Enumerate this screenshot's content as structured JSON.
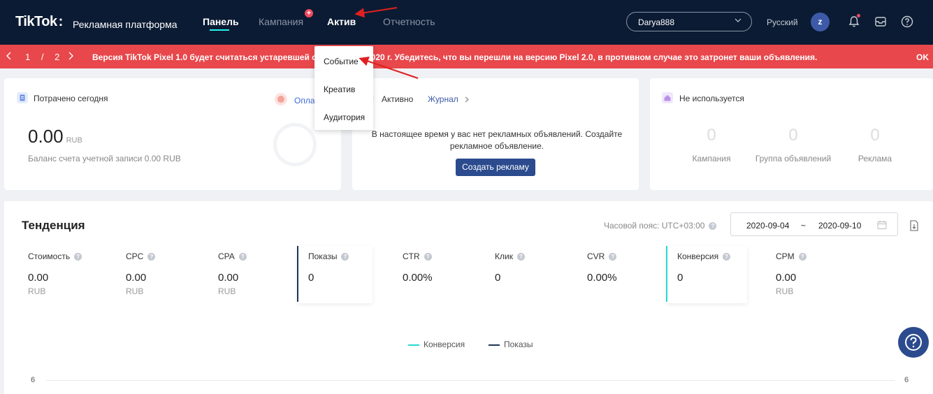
{
  "colors": {
    "nav_bg": "#0b1b33",
    "banner_bg": "#e8474b",
    "accent_cyan": "#25f4ee",
    "button_blue": "#2b4b8e",
    "conversion_line": "#25d9d4",
    "impressions_line": "#1f3556",
    "annotation_arrow": "#e02020"
  },
  "header": {
    "logo": "TikTok",
    "logo_colon": ":",
    "subtitle": "Рекламная платформа",
    "nav": {
      "dashboard": "Панель",
      "campaign": "Кампания",
      "assets": "Актив",
      "reporting": "Отчетность"
    },
    "campaign_badge": "+",
    "account": "Darya888",
    "language": "Русский",
    "avatar_letter": "z",
    "icons": [
      "chevron-down-icon",
      "bell-icon",
      "mailbox-icon",
      "help-icon"
    ]
  },
  "banner": {
    "page": "1 / 2",
    "text": "Версия TikTok Pixel 1.0 будет считаться устаревшей с 15 октября 2020 г. Убедитесь, что вы перешли на версию Pixel 2.0, в противном случае это затронет ваши объявления.",
    "ok": "OK"
  },
  "assets_menu": {
    "items": [
      "Событие",
      "Креатив",
      "Аудитория"
    ]
  },
  "spent_card": {
    "title": "Потрачено сегодня",
    "pay_link": "Оплатить",
    "amount": "0.00",
    "currency": "RUB",
    "balance": "Баланс счета учетной записи 0.00 RUB"
  },
  "active_card": {
    "status": "Активно",
    "log_link": "Журнал",
    "message": "В настоящее время у вас нет рекламных объявлений. Создайте рекламное объявление.",
    "create_button": "Создать рекламу"
  },
  "unused_card": {
    "title": "Не используется",
    "stats": [
      {
        "value": "0",
        "label": "Кампания"
      },
      {
        "value": "0",
        "label": "Группа объявлений"
      },
      {
        "value": "0",
        "label": "Реклама"
      }
    ]
  },
  "trend": {
    "title": "Тенденция",
    "timezone": "Часовой пояс: UTC+03:00",
    "date_from": "2020-09-04",
    "date_sep": "~",
    "date_to": "2020-09-10",
    "metrics": [
      {
        "label": "Стоимость",
        "value": "0.00",
        "unit": "RUB"
      },
      {
        "label": "CPC",
        "value": "0.00",
        "unit": "RUB"
      },
      {
        "label": "CPA",
        "value": "0.00",
        "unit": "RUB"
      },
      {
        "label": "Показы",
        "value": "0",
        "unit": ""
      },
      {
        "label": "CTR",
        "value": "0.00%",
        "unit": ""
      },
      {
        "label": "Клик",
        "value": "0",
        "unit": ""
      },
      {
        "label": "CVR",
        "value": "0.00%",
        "unit": ""
      },
      {
        "label": "Конверсия",
        "value": "0",
        "unit": ""
      },
      {
        "label": "CPM",
        "value": "0.00",
        "unit": "RUB"
      }
    ],
    "legend": {
      "conversion": "Конверсия",
      "impressions": "Показы"
    },
    "y_left_top": "6",
    "y_right_top": "6"
  },
  "help_symbol": "?"
}
